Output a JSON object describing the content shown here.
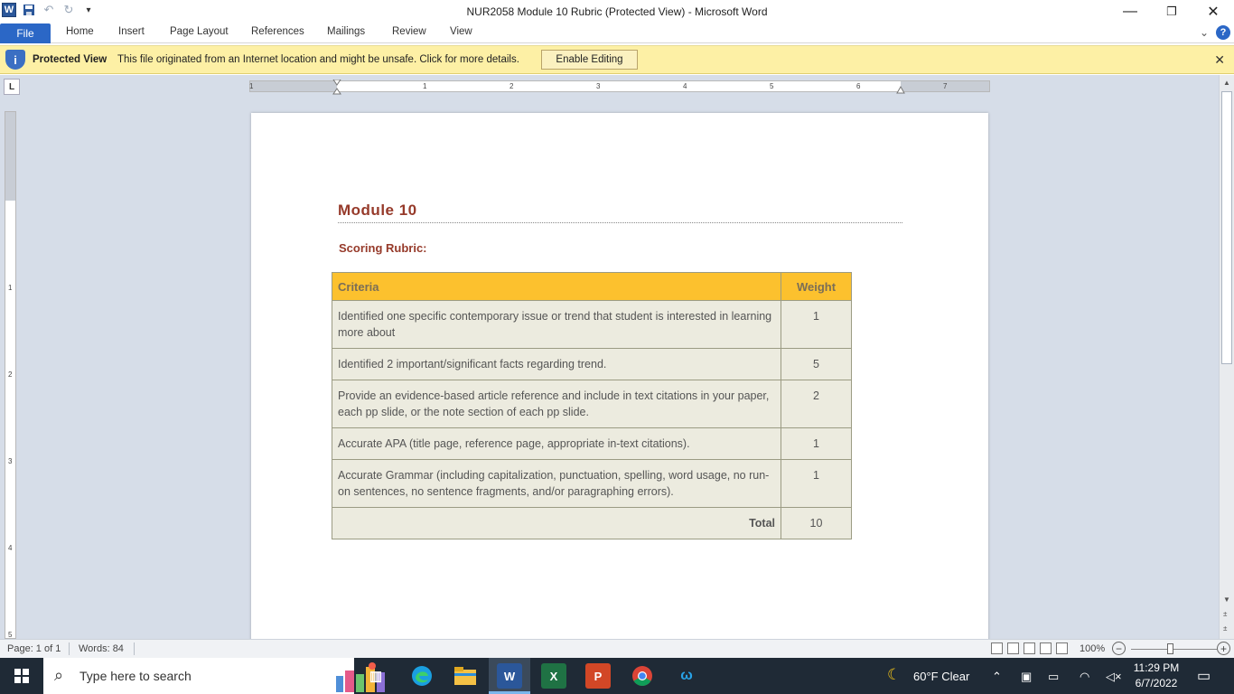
{
  "window": {
    "title": "NUR2058 Module 10 Rubric (Protected View)  -  Microsoft Word",
    "app_icon_letter": "W",
    "controls": {
      "minimize": "—",
      "restore": "❐",
      "close": "✕"
    }
  },
  "quick_access": {
    "undo": "↶",
    "redo": "↻",
    "customize": "▾"
  },
  "ribbon": {
    "file_tab": "File",
    "tabs": [
      "Home",
      "Insert",
      "Page Layout",
      "References",
      "Mailings",
      "Review",
      "View"
    ],
    "minimize_ribbon": "⌄",
    "help": "?"
  },
  "protected_bar": {
    "title": "Protected View",
    "message": "This file originated from an Internet location and might be unsafe. Click for more details.",
    "button": "Enable Editing",
    "close": "✕",
    "icon": "i"
  },
  "ruler": {
    "corner": "L",
    "h_numbers": [
      "1",
      "1",
      "2",
      "3",
      "4",
      "5",
      "6",
      "7"
    ],
    "v_numbers": [
      "1",
      "2",
      "3",
      "4",
      "5"
    ]
  },
  "document": {
    "heading": "Module 10",
    "subheading": "Scoring Rubric:",
    "table": {
      "headers": [
        "Criteria",
        "Weight"
      ],
      "rows": [
        {
          "criteria": "Identified one specific contemporary issue or trend that student is interested in learning more about",
          "weight": "1"
        },
        {
          "criteria": "Identified 2 important/significant facts regarding trend.",
          "weight": "5"
        },
        {
          "criteria": "Provide an evidence-based article reference and include in text citations in your paper, each pp slide, or the note section of each pp slide.",
          "weight": "2"
        },
        {
          "criteria": "Accurate APA (title page, reference page, appropriate in-text citations).",
          "weight": "1"
        },
        {
          "criteria": "Accurate Grammar (including capitalization, punctuation, spelling, word usage, no run-on sentences, no sentence fragments, and/or paragraphing errors).",
          "weight": "1"
        }
      ],
      "total_label": "Total",
      "total_value": "10"
    }
  },
  "status_bar": {
    "page": "Page: 1 of 1",
    "words": "Words: 84",
    "zoom": "100%",
    "zoom_level_percent": 100
  },
  "taskbar": {
    "search_placeholder": "Type here to search",
    "apps": [
      "Task View",
      "Microsoft Edge",
      "File Explorer",
      "Microsoft Word",
      "Microsoft Excel",
      "Microsoft PowerPoint",
      "Google Chrome",
      "Webex"
    ],
    "active_app": "Microsoft Word",
    "weather": "60°F  Clear",
    "time": "11:29 PM",
    "date": "6/7/2022"
  },
  "colors": {
    "heading": "#963a2a",
    "table_header": "#fcc12e",
    "table_cell": "#ecebdf",
    "protected_bar": "#fdf0a5",
    "file_tab": "#2b67c6",
    "taskbar": "#1f2a36"
  }
}
